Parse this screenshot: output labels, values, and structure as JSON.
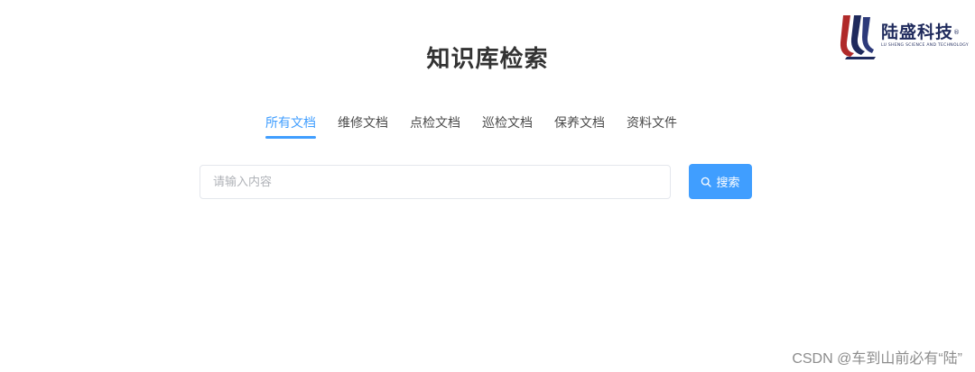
{
  "logo": {
    "name": "陆盛科技",
    "mark": "®",
    "subtitle": "LU SHENG SCIENCE AND TECHNOLOGY"
  },
  "page": {
    "title": "知识库检索"
  },
  "tabs": [
    {
      "label": "所有文档",
      "active": true
    },
    {
      "label": "维修文档",
      "active": false
    },
    {
      "label": "点检文档",
      "active": false
    },
    {
      "label": "巡检文档",
      "active": false
    },
    {
      "label": "保养文档",
      "active": false
    },
    {
      "label": "资料文件",
      "active": false
    }
  ],
  "search": {
    "placeholder": "请输入内容",
    "value": "",
    "button_label": "搜索",
    "icon": "search-icon"
  },
  "watermark": {
    "text": "CSDN @车到山前必有“陆”"
  },
  "colors": {
    "accent": "#409eff",
    "title": "#333333",
    "logo_navy": "#1f2a5c",
    "logo_red": "#b02a2a"
  }
}
